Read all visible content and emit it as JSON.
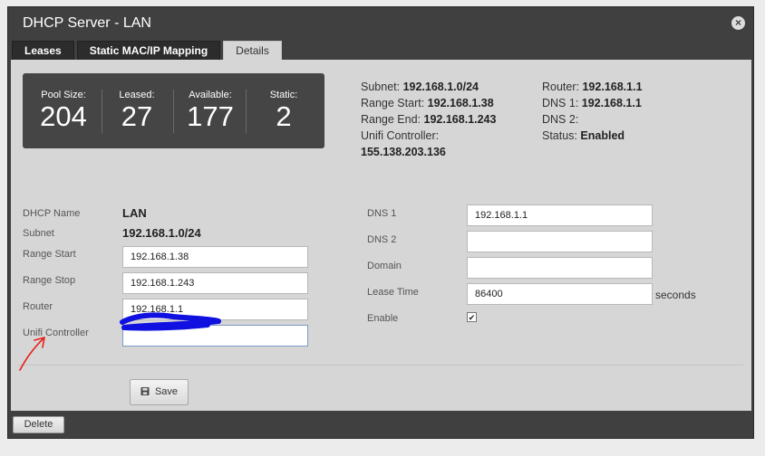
{
  "dialog": {
    "title": "DHCP Server - LAN",
    "close_glyph": "×"
  },
  "tabs": [
    {
      "label": "Leases"
    },
    {
      "label": "Static MAC/IP Mapping"
    },
    {
      "label": "Details",
      "active": true
    }
  ],
  "stats": [
    {
      "label": "Pool Size:",
      "value": "204"
    },
    {
      "label": "Leased:",
      "value": "27"
    },
    {
      "label": "Available:",
      "value": "177"
    },
    {
      "label": "Static:",
      "value": "2"
    }
  ],
  "summary_left": {
    "subnet_label": "Subnet:",
    "subnet_value": "192.168.1.0/24",
    "range_start_label": "Range Start:",
    "range_start_value": "192.168.1.38",
    "range_end_label": "Range End:",
    "range_end_value": "192.168.1.243",
    "unifi_label": "Unifi Controller:",
    "unifi_value": "155.138.203.136"
  },
  "summary_right": {
    "router_label": "Router:",
    "router_value": "192.168.1.1",
    "dns1_label": "DNS 1:",
    "dns1_value": "192.168.1.1",
    "dns2_label": "DNS 2:",
    "dns2_value": "",
    "status_label": "Status:",
    "status_value": "Enabled"
  },
  "form_left": {
    "dhcp_name_label": "DHCP Name",
    "dhcp_name_value": "LAN",
    "subnet_label": "Subnet",
    "subnet_value": "192.168.1.0/24",
    "range_start_label": "Range Start",
    "range_start_value": "192.168.1.38",
    "range_stop_label": "Range Stop",
    "range_stop_value": "192.168.1.243",
    "router_label": "Router",
    "router_value": "192.168.1.1",
    "unifi_label": "Unifi Controller",
    "unifi_value": ""
  },
  "form_right": {
    "dns1_label": "DNS 1",
    "dns1_value": "192.168.1.1",
    "dns2_label": "DNS 2",
    "dns2_value": "",
    "domain_label": "Domain",
    "domain_value": "",
    "lease_label": "Lease Time",
    "lease_value": "86400",
    "lease_unit": "seconds",
    "enable_label": "Enable",
    "enable_checked": true,
    "check_glyph": "✔"
  },
  "buttons": {
    "save": "Save",
    "delete": "Delete"
  },
  "icons": {
    "save": "floppy-disk-icon",
    "close": "close-icon"
  },
  "colors": {
    "dialog_bg": "#404040",
    "panel_bg": "#d6d6d6",
    "stats_bg": "#454545",
    "annotation_red": "#e8201a",
    "redaction_blue": "#1010e0"
  }
}
